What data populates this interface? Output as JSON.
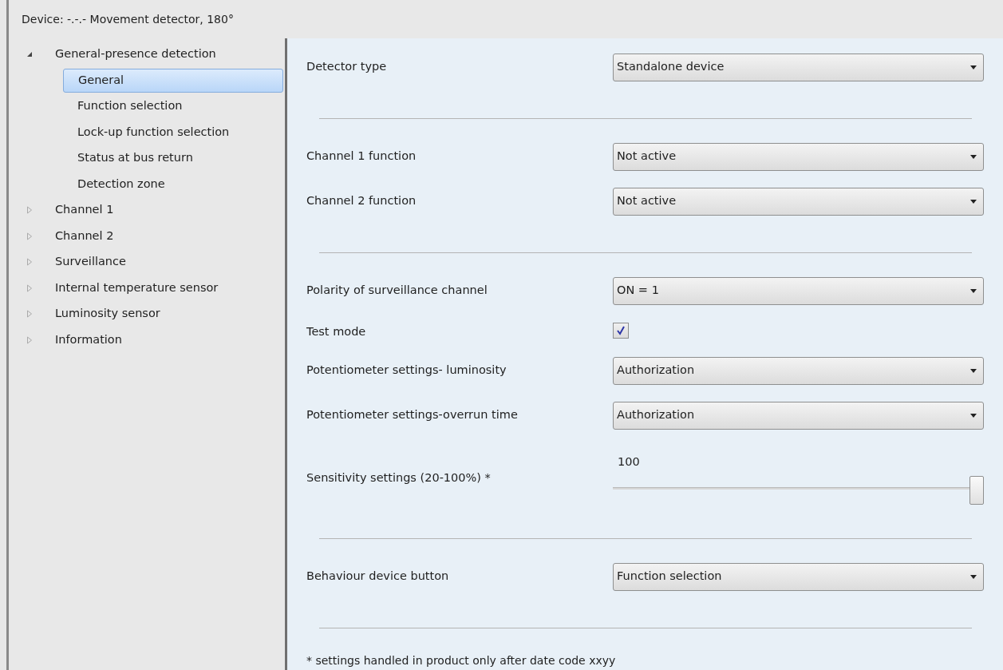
{
  "window": {
    "title": "Device: -.-.-  Movement detector, 180°"
  },
  "tree": [
    {
      "label": "General-presence detection",
      "expanded": true,
      "selected": false,
      "children": [
        {
          "label": "General",
          "selected": true
        },
        {
          "label": "Function selection",
          "selected": false
        },
        {
          "label": "Lock-up function selection",
          "selected": false
        },
        {
          "label": "Status at bus return",
          "selected": false
        },
        {
          "label": "Detection zone",
          "selected": false
        }
      ]
    },
    {
      "label": "Channel 1",
      "expanded": false,
      "selected": false
    },
    {
      "label": "Channel 2",
      "expanded": false,
      "selected": false
    },
    {
      "label": "Surveillance",
      "expanded": false,
      "selected": false
    },
    {
      "label": "Internal temperature sensor",
      "expanded": false,
      "selected": false
    },
    {
      "label": "Luminosity sensor",
      "expanded": false,
      "selected": false
    },
    {
      "label": "Information",
      "expanded": false,
      "selected": false
    }
  ],
  "settings": [
    {
      "kind": "dropdown",
      "label": "Detector type",
      "value": "Standalone device"
    },
    {
      "kind": "separator"
    },
    {
      "kind": "dropdown",
      "label": "Channel 1 function",
      "value": "Not active"
    },
    {
      "kind": "dropdown",
      "label": "Channel 2 function",
      "value": "Not active"
    },
    {
      "kind": "separator"
    },
    {
      "kind": "dropdown",
      "label": "Polarity of surveillance channel",
      "value": "ON = 1"
    },
    {
      "kind": "checkbox",
      "label": "Test mode",
      "checked": true
    },
    {
      "kind": "dropdown",
      "label": "Potentiometer settings- luminosity",
      "value": "Authorization"
    },
    {
      "kind": "dropdown",
      "label": "Potentiometer settings-overrun time",
      "value": "Authorization"
    },
    {
      "kind": "slider",
      "label": "Sensitivity settings (20-100%) *",
      "reading": "100",
      "level": 1
    },
    {
      "kind": "separator"
    },
    {
      "kind": "dropdown",
      "label": "Behaviour device button",
      "value": "Function selection"
    },
    {
      "kind": "separator"
    },
    {
      "kind": "note",
      "label": "* settings handled in product only after date code xxyy"
    }
  ]
}
